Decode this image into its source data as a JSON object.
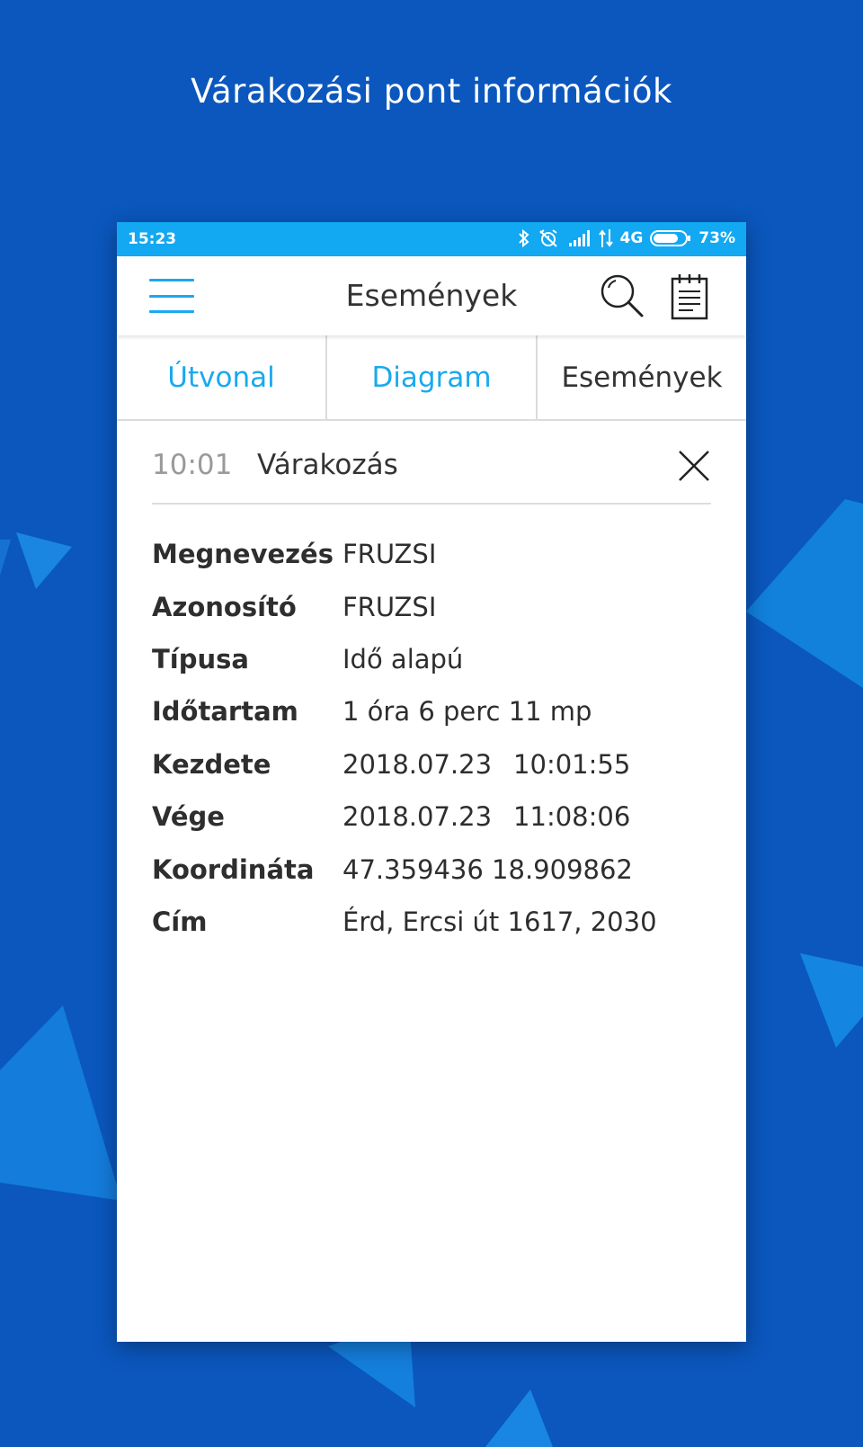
{
  "headline": "Várakozási pont információk",
  "statusbar": {
    "time": "15:23",
    "network": "4G",
    "battery": "73%",
    "icons": [
      "bluetooth-icon",
      "alarm-off-icon",
      "signal-icon",
      "data-transfer-icon",
      "battery-icon"
    ]
  },
  "appbar": {
    "title": "Események",
    "icons": [
      "menu-icon",
      "search-icon",
      "notepad-icon"
    ]
  },
  "tabs": [
    {
      "label": "Útvonal"
    },
    {
      "label": "Diagram"
    },
    {
      "label": "Események"
    }
  ],
  "event": {
    "time": "10:01",
    "type": "Várakozás",
    "close_icon": "close-icon"
  },
  "details": [
    {
      "label": "Megnevezés",
      "value": "FRUZSI"
    },
    {
      "label": "Azonosító",
      "value": "FRUZSI"
    },
    {
      "label": "Típusa",
      "value": "Idő alapú"
    },
    {
      "label": "Időtartam",
      "value": "1 óra 6 perc 11 mp"
    },
    {
      "label": "Kezdete",
      "date": "2018.07.23",
      "time": "10:01:55"
    },
    {
      "label": "Vége",
      "date": "2018.07.23",
      "time": "11:08:06"
    },
    {
      "label": "Koordináta",
      "value": "47.359436 18.909862"
    },
    {
      "label": "Cím",
      "value": "Érd, Ercsi út 1617, 2030"
    }
  ],
  "colors": {
    "background": "#0b57be",
    "accent": "#19a9ee",
    "statusbar": "#13a8f2",
    "text": "#333333",
    "muted": "#9a9a9a"
  }
}
